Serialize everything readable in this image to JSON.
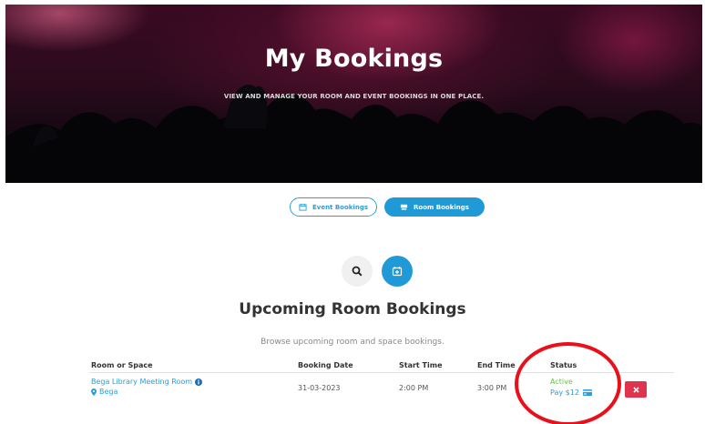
{
  "hero": {
    "title": "My Bookings",
    "subtitle": "VIEW AND MANAGE YOUR ROOM AND EVENT BOOKINGS IN ONE PLACE."
  },
  "tabs": [
    {
      "label": "Event Bookings",
      "icon": "calendar-icon",
      "active": false
    },
    {
      "label": "Room Bookings",
      "icon": "room-icon",
      "active": true
    }
  ],
  "toolbar": {
    "search_icon": "search-icon",
    "calendar_icon": "calendar-add-icon"
  },
  "section": {
    "title": "Upcoming Room Bookings",
    "description": "Browse upcoming room and space bookings."
  },
  "table": {
    "headers": [
      "Room or Space",
      "Booking Date",
      "Start Time",
      "End Time",
      "Status"
    ],
    "rows": [
      {
        "room": "Bega Library Meeting Room",
        "location": "Bega",
        "date": "31-03-2023",
        "start": "2:00 PM",
        "end": "3:00 PM",
        "status": "Active",
        "pay": "Pay $12",
        "delete_icon": "close-icon"
      }
    ]
  },
  "colors": {
    "accent": "#1f9ad6",
    "active": "#6cc04a",
    "danger": "#e0344e",
    "annotation": "#e8101b"
  }
}
